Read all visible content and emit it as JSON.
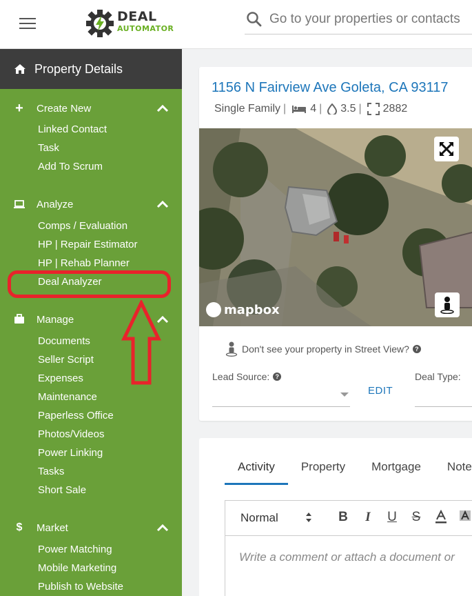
{
  "header": {
    "logo_top": "DEAL",
    "logo_bottom": "AUTOMATOR",
    "search_placeholder": "Go to your properties or contacts"
  },
  "sidebar": {
    "title": "Property Details",
    "sections": [
      {
        "label": "Create New",
        "icon": "plus-icon",
        "items": [
          "Linked Contact",
          "Task",
          "Add To Scrum"
        ]
      },
      {
        "label": "Analyze",
        "icon": "laptop-icon",
        "items": [
          "Comps / Evaluation",
          "HP | Repair Estimator",
          "HP | Rehab Planner",
          "Deal Analyzer"
        ]
      },
      {
        "label": "Manage",
        "icon": "briefcase-icon",
        "items": [
          "Documents",
          "Seller Script",
          "Expenses",
          "Maintenance",
          "Paperless Office",
          "Photos/Videos",
          "Power Linking",
          "Tasks",
          "Short Sale"
        ]
      },
      {
        "label": "Market",
        "icon": "dollar-icon",
        "items": [
          "Power Matching",
          "Mobile Marketing",
          "Publish to Website"
        ]
      }
    ]
  },
  "property": {
    "address": "1156 N Fairview Ave Goleta, CA 93117",
    "type": "Single Family",
    "beds": "4",
    "baths": "3.5",
    "sqft": "2882",
    "map_attribution": "mapbox",
    "streetview_note": "Don't see your property in Street View?",
    "lead_source_label": "Lead Source:",
    "edit_label": "EDIT",
    "deal_type_label": "Deal Type:"
  },
  "activity": {
    "tabs": [
      "Activity",
      "Property",
      "Mortgage",
      "Notes"
    ],
    "format_value": "Normal",
    "comment_placeholder": "Write a comment or attach a document or"
  },
  "colors": {
    "sidebar_green": "#6aa039",
    "header_dark": "#3d3d3d",
    "link_blue": "#1d76ba",
    "highlight_red": "#e8232b"
  }
}
